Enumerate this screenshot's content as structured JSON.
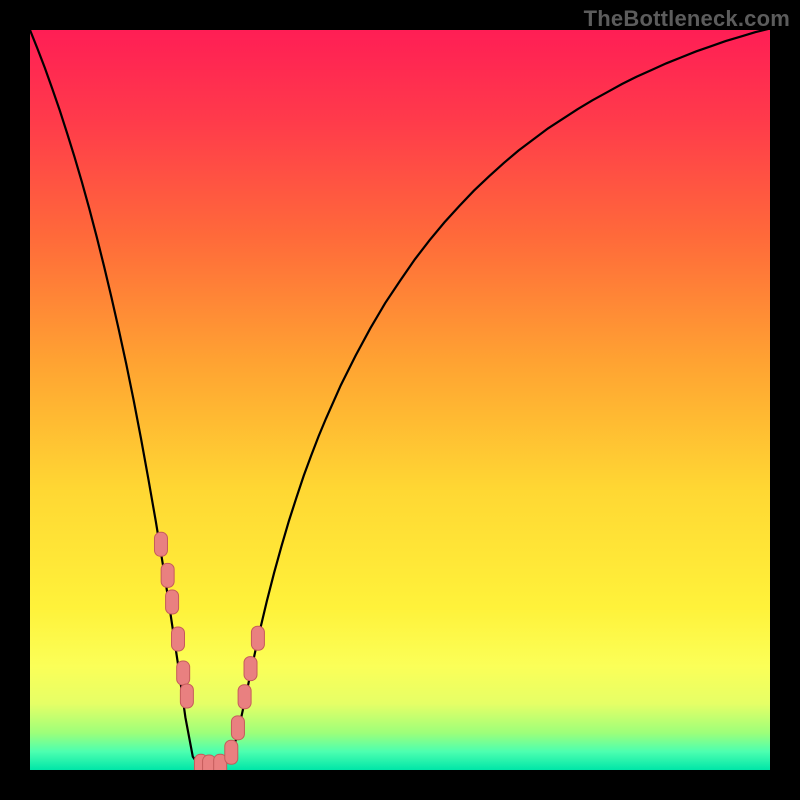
{
  "watermark": "TheBottleneck.com",
  "colors": {
    "frame": "#000000",
    "curve": "#000000",
    "marker_fill": "#e98080",
    "marker_stroke": "#c55b5b",
    "gradient_stops": [
      {
        "offset": 0.0,
        "color": "#ff1e55"
      },
      {
        "offset": 0.12,
        "color": "#ff3a4b"
      },
      {
        "offset": 0.28,
        "color": "#ff6a3a"
      },
      {
        "offset": 0.45,
        "color": "#ffa332"
      },
      {
        "offset": 0.62,
        "color": "#ffd733"
      },
      {
        "offset": 0.78,
        "color": "#fff23a"
      },
      {
        "offset": 0.86,
        "color": "#fbff58"
      },
      {
        "offset": 0.91,
        "color": "#e6ff66"
      },
      {
        "offset": 0.95,
        "color": "#9dff7a"
      },
      {
        "offset": 0.975,
        "color": "#4dffb0"
      },
      {
        "offset": 1.0,
        "color": "#00e6a8"
      }
    ]
  },
  "chart_data": {
    "type": "line",
    "title": "",
    "xlabel": "",
    "ylabel": "",
    "xlim": [
      0,
      100
    ],
    "ylim": [
      0,
      100
    ],
    "x": [
      0,
      1,
      2,
      3,
      4,
      5,
      6,
      7,
      8,
      9,
      10,
      11,
      12,
      13,
      14,
      15,
      16,
      17,
      18,
      19,
      20,
      21,
      22,
      23,
      24,
      25,
      26,
      27,
      28,
      29,
      30,
      31,
      32,
      33,
      34,
      35,
      36,
      37,
      38,
      39,
      40,
      42,
      44,
      46,
      48,
      50,
      52,
      54,
      56,
      58,
      60,
      62,
      64,
      66,
      68,
      70,
      72,
      74,
      76,
      78,
      80,
      82,
      84,
      86,
      88,
      90,
      92,
      94,
      96,
      98,
      100
    ],
    "values": [
      100,
      97.5,
      94.9,
      92.1,
      89.2,
      86.1,
      82.9,
      79.5,
      75.9,
      72.1,
      68.1,
      63.9,
      59.5,
      54.9,
      50.0,
      44.8,
      39.3,
      33.6,
      27.5,
      21.0,
      14.3,
      7.1,
      1.8,
      0.4,
      0.3,
      0.4,
      0.6,
      1.6,
      4.6,
      9.2,
      14.0,
      18.6,
      22.8,
      26.7,
      30.3,
      33.7,
      36.8,
      39.8,
      42.5,
      45.1,
      47.5,
      52.0,
      56.0,
      59.7,
      63.1,
      66.1,
      69.0,
      71.6,
      74.0,
      76.2,
      78.3,
      80.2,
      82.0,
      83.7,
      85.2,
      86.7,
      88.0,
      89.3,
      90.5,
      91.6,
      92.7,
      93.7,
      94.6,
      95.5,
      96.3,
      97.1,
      97.8,
      98.5,
      99.1,
      99.7,
      100.2
    ],
    "markers_x": [
      17.7,
      18.6,
      19.2,
      20.0,
      20.7,
      21.2,
      23.1,
      24.2,
      25.7,
      27.2,
      28.1,
      29.0,
      29.8,
      30.8
    ],
    "markers_y": [
      30.5,
      26.3,
      22.7,
      17.7,
      13.1,
      10.0,
      0.5,
      0.4,
      0.5,
      2.4,
      5.7,
      9.9,
      13.7,
      17.8
    ]
  }
}
